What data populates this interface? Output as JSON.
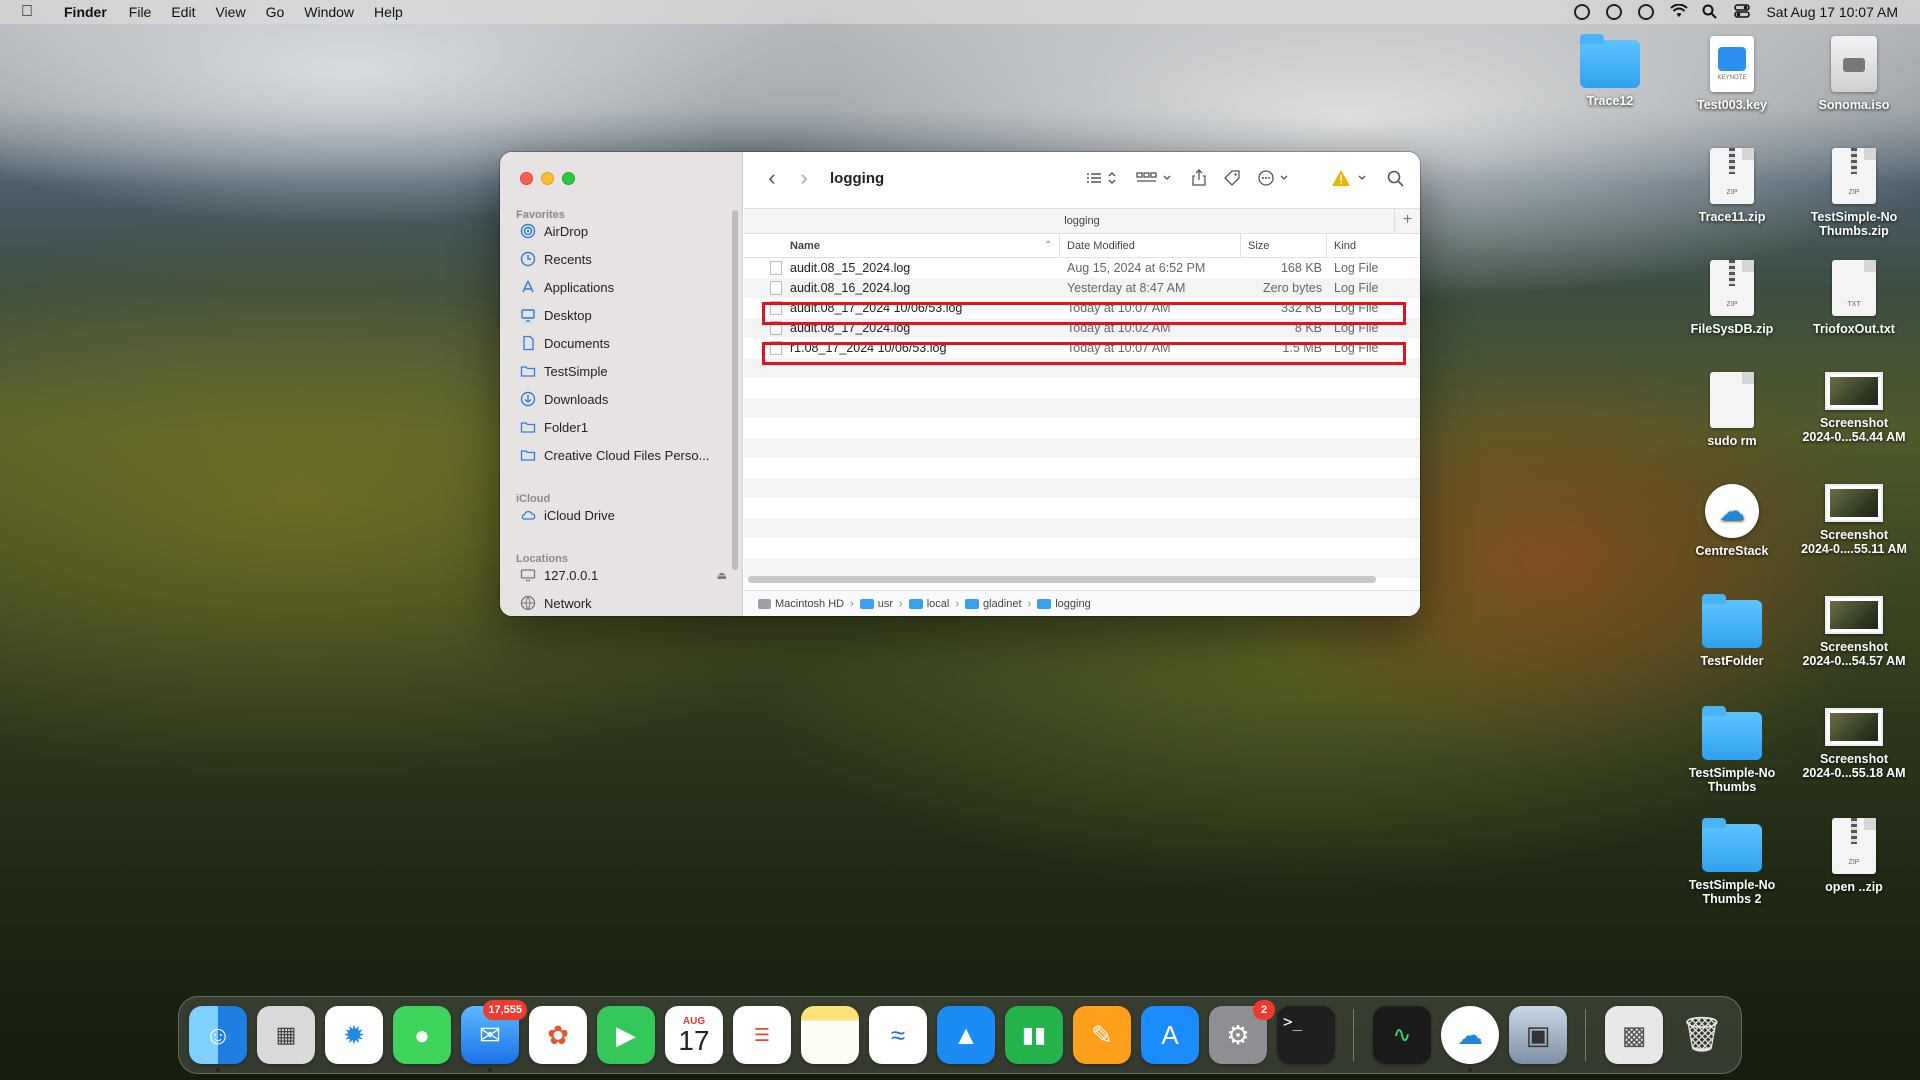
{
  "menubar": {
    "app": "Finder",
    "items": [
      "File",
      "Edit",
      "View",
      "Go",
      "Window",
      "Help"
    ],
    "datetime": "Sat Aug 17  10:07 AM"
  },
  "finder": {
    "title": "logging",
    "path_tab": "logging",
    "sidebar": {
      "favorites_header": "Favorites",
      "favorites": [
        "AirDrop",
        "Recents",
        "Applications",
        "Desktop",
        "Documents",
        "TestSimple",
        "Downloads",
        "Folder1",
        "Creative Cloud Files Perso..."
      ],
      "icloud_header": "iCloud",
      "icloud": [
        "iCloud Drive"
      ],
      "locations_header": "Locations",
      "locations": [
        "127.0.0.1",
        "Network"
      ]
    },
    "columns": {
      "name": "Name",
      "date": "Date Modified",
      "size": "Size",
      "kind": "Kind"
    },
    "files": [
      {
        "name": "audit.08_15_2024.log",
        "date": "Aug 15, 2024 at 6:52 PM",
        "size": "168 KB",
        "kind": "Log File"
      },
      {
        "name": "audit.08_16_2024.log",
        "date": "Yesterday at 8:47 AM",
        "size": "Zero bytes",
        "kind": "Log File"
      },
      {
        "name": "audit.08_17_2024 10/06/53.log",
        "date": "Today at 10:07 AM",
        "size": "332 KB",
        "kind": "Log File"
      },
      {
        "name": "audit.08_17_2024.log",
        "date": "Today at 10:02 AM",
        "size": "8 KB",
        "kind": "Log File"
      },
      {
        "name": "r1.08_17_2024 10/06/53.log",
        "date": "Today at 10:07 AM",
        "size": "1.5 MB",
        "kind": "Log File"
      }
    ],
    "pathbar": [
      "Macintosh HD",
      "usr",
      "local",
      "gladinet",
      "logging"
    ]
  },
  "desktop": {
    "trace12": "Trace12",
    "test003": "Test003.key",
    "test003_tag": "KEYNOTE",
    "sonoma": "Sonoma.iso",
    "trace11": "Trace11.zip",
    "testsimple_zip_1": "TestSimple-No",
    "testsimple_zip_2": "Thumbs.zip",
    "filesysdb": "FileSysDB.zip",
    "triofox": "TriofoxOut.txt",
    "sudo": "sudo rm",
    "shot1_1": "Screenshot",
    "shot1_2": "2024-0...54.44 AM",
    "centrestack": "CentreStack",
    "shot2_1": "Screenshot",
    "shot2_2": "2024-0....55.11 AM",
    "testfolder": "TestFolder",
    "shot3_1": "Screenshot",
    "shot3_2": "2024-0...54.57 AM",
    "tsn_1": "TestSimple-No",
    "tsn_2": "Thumbs",
    "shot4_1": "Screenshot",
    "shot4_2": "2024-0...55.18 AM",
    "tsn2_1": "TestSimple-No",
    "tsn2_2": "Thumbs 2",
    "openzip": "open ..zip",
    "zip_tag": "ZIP",
    "txt_tag": "TXT"
  },
  "dock": {
    "mail_badge": "17,555",
    "calendar_month": "AUG",
    "calendar_day": "17",
    "settings_badge": "2",
    "terminal_prompt": ">_"
  },
  "colors": {
    "highlight": "#e0141e",
    "folder": "#2fa2ee",
    "badge": "#f03a2e"
  }
}
